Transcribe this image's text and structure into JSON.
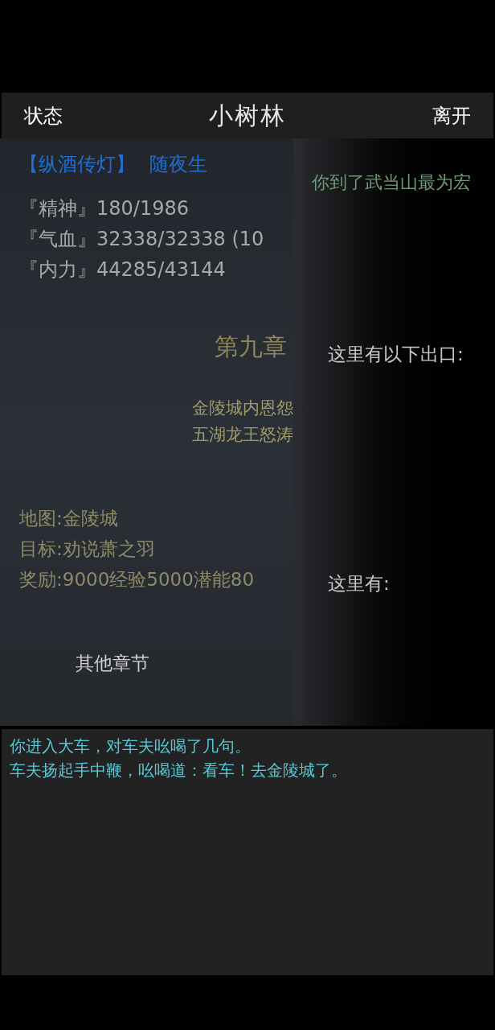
{
  "header": {
    "left_button": "状态",
    "title": "小树林",
    "right_button": "离开"
  },
  "status": {
    "tag": "【纵酒传灯】",
    "name": "随夜生",
    "stats": [
      "『精神』180/1986",
      "『气血』32338/32338 (10",
      "『内力』44285/43144"
    ]
  },
  "chapter": {
    "title": "第九章",
    "summary": [
      "金陵城内恩怨",
      "五湖龙王怒涛"
    ],
    "details": [
      "地图:金陵城",
      "目标:劝说萧之羽",
      "奖励:9000经验5000潜能80"
    ],
    "other_button": "其他章节"
  },
  "room": {
    "description": "你到了武当山最为宏",
    "exits_label": "这里有以下出口:",
    "here_label": "这里有:"
  },
  "log": {
    "lines": [
      "你进入大车，对车夫吆喝了几句。",
      "车夫扬起手中鞭，吆喝道：看车！去金陵城了。"
    ]
  }
}
